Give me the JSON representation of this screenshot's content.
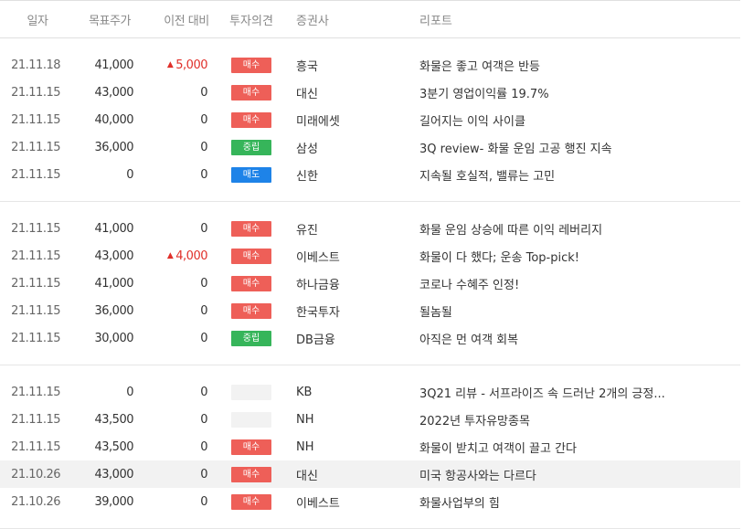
{
  "header": {
    "date": "일자",
    "target_price": "목표주가",
    "change": "이전 대비",
    "opinion": "투자의견",
    "broker": "증권사",
    "report": "리포트"
  },
  "groups": [
    {
      "rows": [
        {
          "date": "21.11.18",
          "target": "41,000",
          "change": "5,000",
          "change_dir": "up",
          "opinion": "매수",
          "opinion_type": "buy",
          "broker": "흥국",
          "report": "화물은 좋고 여객은 반등"
        },
        {
          "date": "21.11.15",
          "target": "43,000",
          "change": "0",
          "change_dir": "none",
          "opinion": "매수",
          "opinion_type": "buy",
          "broker": "대신",
          "report": "3분기 영업이익률 19.7%"
        },
        {
          "date": "21.11.15",
          "target": "40,000",
          "change": "0",
          "change_dir": "none",
          "opinion": "매수",
          "opinion_type": "buy",
          "broker": "미래에셋",
          "report": "길어지는 이익 사이클"
        },
        {
          "date": "21.11.15",
          "target": "36,000",
          "change": "0",
          "change_dir": "none",
          "opinion": "중립",
          "opinion_type": "neutral",
          "broker": "삼성",
          "report": "3Q review- 화물 운임 고공 행진 지속"
        },
        {
          "date": "21.11.15",
          "target": "0",
          "change": "0",
          "change_dir": "none",
          "opinion": "매도",
          "opinion_type": "sell",
          "broker": "신한",
          "report": "지속될 호실적, 밸류는 고민"
        }
      ]
    },
    {
      "rows": [
        {
          "date": "21.11.15",
          "target": "41,000",
          "change": "0",
          "change_dir": "none",
          "opinion": "매수",
          "opinion_type": "buy",
          "broker": "유진",
          "report": "화물 운임 상승에 따른 이익 레버리지"
        },
        {
          "date": "21.11.15",
          "target": "43,000",
          "change": "4,000",
          "change_dir": "up",
          "opinion": "매수",
          "opinion_type": "buy",
          "broker": "이베스트",
          "report": "화물이 다 했다; 운송 Top-pick!"
        },
        {
          "date": "21.11.15",
          "target": "41,000",
          "change": "0",
          "change_dir": "none",
          "opinion": "매수",
          "opinion_type": "buy",
          "broker": "하나금융",
          "report": "코로나 수혜주 인정!"
        },
        {
          "date": "21.11.15",
          "target": "36,000",
          "change": "0",
          "change_dir": "none",
          "opinion": "매수",
          "opinion_type": "buy",
          "broker": "한국투자",
          "report": "될놈될"
        },
        {
          "date": "21.11.15",
          "target": "30,000",
          "change": "0",
          "change_dir": "none",
          "opinion": "중립",
          "opinion_type": "neutral",
          "broker": "DB금융",
          "report": "아직은 먼 여객 회복"
        }
      ]
    },
    {
      "rows": [
        {
          "date": "21.11.15",
          "target": "0",
          "change": "0",
          "change_dir": "none",
          "opinion": "",
          "opinion_type": "none",
          "broker": "KB",
          "report": "3Q21 리뷰 - 서프라이즈 속 드러난 2개의 긍정..."
        },
        {
          "date": "21.11.15",
          "target": "43,500",
          "change": "0",
          "change_dir": "none",
          "opinion": "",
          "opinion_type": "none",
          "broker": "NH",
          "report": "2022년 투자유망종목"
        },
        {
          "date": "21.11.15",
          "target": "43,500",
          "change": "0",
          "change_dir": "none",
          "opinion": "매수",
          "opinion_type": "buy",
          "broker": "NH",
          "report": "화물이 받치고 여객이 끌고 간다"
        },
        {
          "date": "21.10.26",
          "target": "43,000",
          "change": "0",
          "change_dir": "none",
          "opinion": "매수",
          "opinion_type": "buy",
          "broker": "대신",
          "report": "미국 항공사와는 다르다",
          "highlighted": true
        },
        {
          "date": "21.10.26",
          "target": "39,000",
          "change": "0",
          "change_dir": "none",
          "opinion": "매수",
          "opinion_type": "buy",
          "broker": "이베스트",
          "report": "화물사업부의 힘"
        }
      ]
    }
  ],
  "colors": {
    "buy": "#ee5f58",
    "neutral": "#36b55a",
    "sell": "#1e83e8",
    "up": "#e0302a"
  }
}
